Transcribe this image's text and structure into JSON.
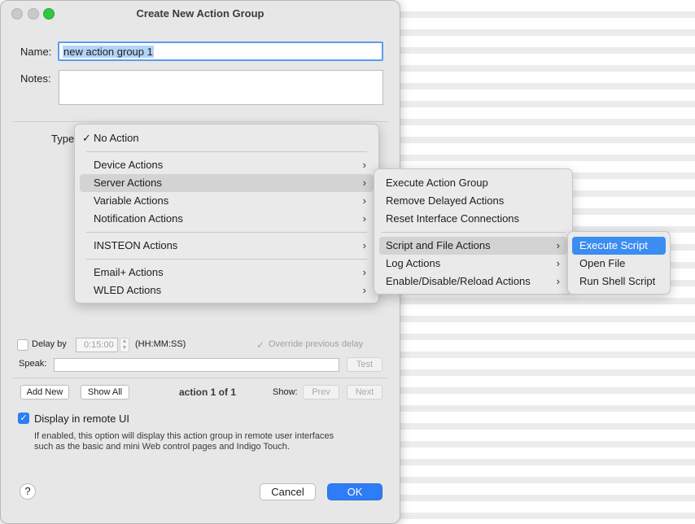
{
  "dialog": {
    "title": "Create New Action Group",
    "name_label": "Name:",
    "name_value": "new action group 1",
    "notes_label": "Notes:",
    "notes_value": "",
    "type_label": "Type",
    "delay_label": "Delay by",
    "delay_value": "0:15:00",
    "delay_unit": "(HH:MM:SS)",
    "override_label": "Override previous delay",
    "speak_label": "Speak:",
    "speak_value": "",
    "test_label": "Test",
    "add_new_label": "Add New",
    "show_all_label": "Show All",
    "action_counter": "action 1 of 1",
    "show_label": "Show:",
    "prev_label": "Prev",
    "next_label": "Next",
    "display_remote_label": "Display in remote UI",
    "display_remote_desc_1": "If enabled, this option will display this action group in remote user interfaces",
    "display_remote_desc_2": "such as the basic and mini Web control pages and Indigo Touch.",
    "help_label": "?",
    "cancel_label": "Cancel",
    "ok_label": "OK"
  },
  "type_menu": {
    "checkmark": "✓",
    "no_action": "No Action",
    "items": [
      "Device Actions",
      "Server Actions",
      "Variable Actions",
      "Notification Actions",
      "INSTEON Actions",
      "Email+ Actions",
      "WLED Actions"
    ],
    "highlighted": "Server Actions"
  },
  "server_menu": {
    "items": [
      "Execute Action Group",
      "Remove Delayed Actions",
      "Reset Interface Connections",
      "Script and File Actions",
      "Log Actions",
      "Enable/Disable/Reload Actions"
    ],
    "highlighted": "Script and File Actions"
  },
  "script_menu": {
    "items": [
      "Execute Script",
      "Open File",
      "Run Shell Script"
    ],
    "selected": "Execute Script"
  },
  "colors": {
    "accent": "#2e7cf6",
    "menu_highlight": "#3b8df2"
  }
}
